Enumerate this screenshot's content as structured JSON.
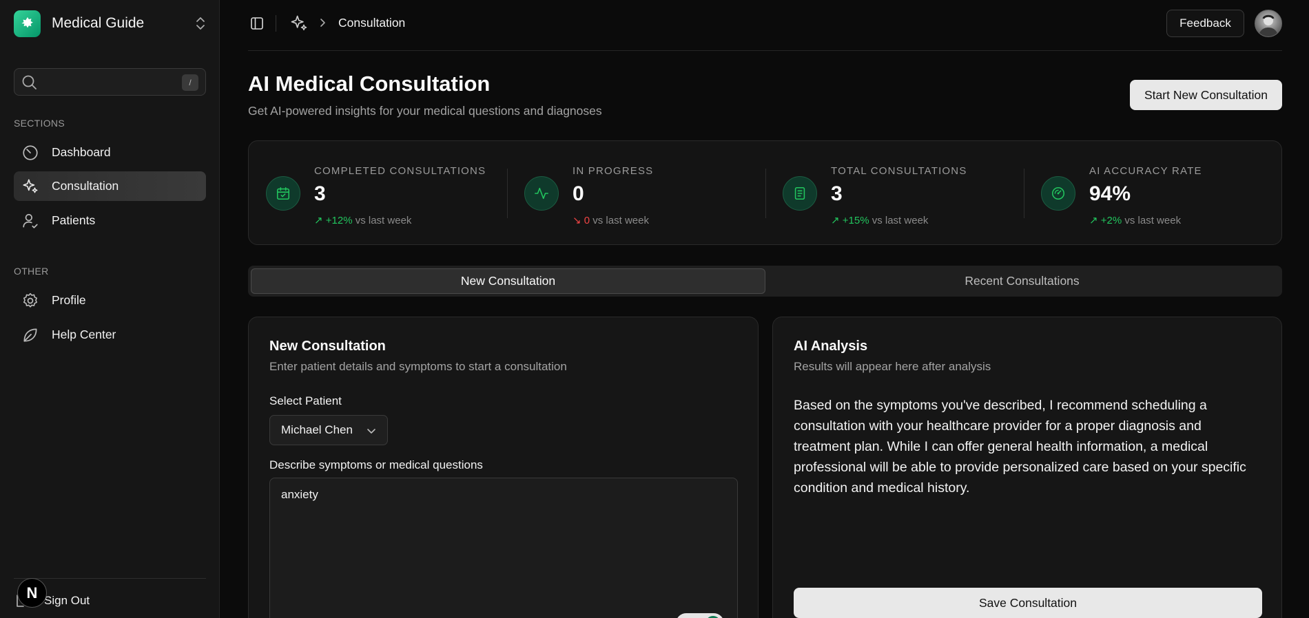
{
  "brand": {
    "name": "Medical Guide"
  },
  "search": {
    "placeholder": "",
    "shortcut": "/"
  },
  "sidebar": {
    "sections_label": "SECTIONS",
    "sections": [
      {
        "label": "Dashboard",
        "icon": "gauge-icon"
      },
      {
        "label": "Consultation",
        "icon": "sparkles-icon"
      },
      {
        "label": "Patients",
        "icon": "user-check-icon"
      }
    ],
    "other_label": "OTHER",
    "other": [
      {
        "label": "Profile",
        "icon": "gear-icon"
      },
      {
        "label": "Help Center",
        "icon": "leaf-icon"
      }
    ],
    "sign_out": "Sign Out"
  },
  "topbar": {
    "breadcrumb": "Consultation",
    "feedback": "Feedback"
  },
  "page": {
    "title": "AI Medical Consultation",
    "subtitle": "Get AI-powered insights for your medical questions and diagnoses",
    "primary_action": "Start New Consultation"
  },
  "stats": [
    {
      "label": "COMPLETED CONSULTATIONS",
      "value": "3",
      "delta": "+12%",
      "delta_suffix": "vs last week",
      "trend": "up",
      "icon": "calendar-check-icon"
    },
    {
      "label": "IN PROGRESS",
      "value": "0",
      "delta": "0",
      "delta_suffix": "vs last week",
      "trend": "down",
      "icon": "activity-icon"
    },
    {
      "label": "TOTAL CONSULTATIONS",
      "value": "3",
      "delta": "+15%",
      "delta_suffix": "vs last week",
      "trend": "up",
      "icon": "document-icon"
    },
    {
      "label": "AI ACCURACY RATE",
      "value": "94%",
      "delta": "+2%",
      "delta_suffix": "vs last week",
      "trend": "up",
      "icon": "speedometer-icon"
    }
  ],
  "tabs": [
    {
      "label": "New Consultation",
      "active": true
    },
    {
      "label": "Recent Consultations",
      "active": false
    }
  ],
  "new_consultation": {
    "title": "New Consultation",
    "description": "Enter patient details and symptoms to start a consultation",
    "patient_label": "Select Patient",
    "patient_value": "Michael Chen",
    "symptoms_label": "Describe symptoms or medical questions",
    "symptoms_value": "anxiety"
  },
  "analysis": {
    "title": "AI Analysis",
    "description": "Results will appear here after analysis",
    "text": "Based on the symptoms you've described, I recommend scheduling a consultation with your healthcare provider for a proper diagnosis and treatment plan. While I can offer general health information, a medical professional will be able to provide personalized care based on your specific condition and medical history.",
    "save": "Save Consultation"
  },
  "colors": {
    "accent": "#22c55e",
    "negative": "#ef4444",
    "background": "#0b0b0b"
  }
}
